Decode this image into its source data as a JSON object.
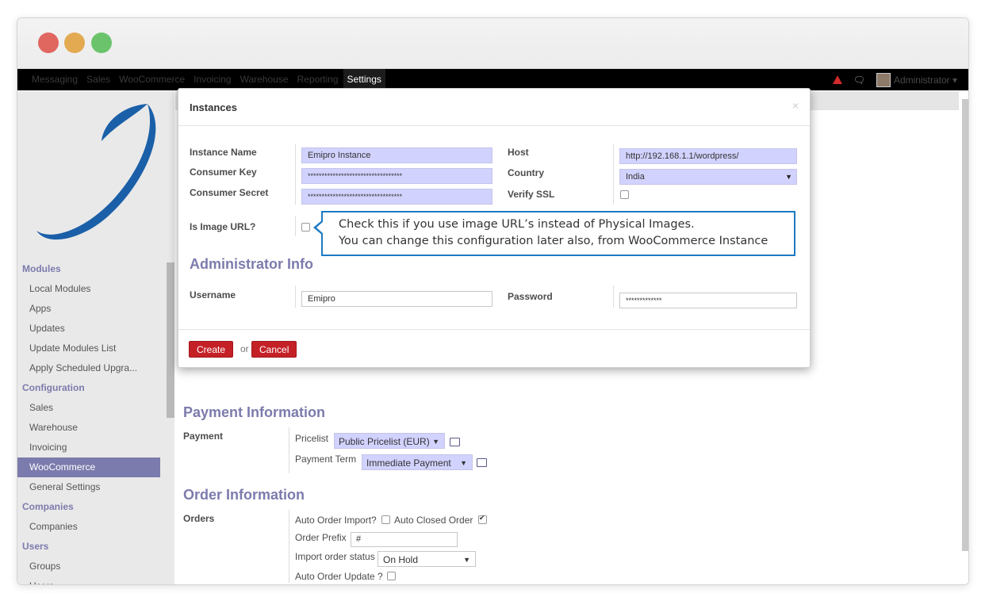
{
  "topnav": {
    "menu": [
      "Messaging",
      "Sales",
      "WooCommerce",
      "Invoicing",
      "Warehouse",
      "Reporting",
      "Settings"
    ],
    "active": "Settings",
    "user": "Administrator"
  },
  "sidebar": {
    "sections": [
      {
        "title": "Modules",
        "items": [
          "Local Modules",
          "Apps",
          "Updates",
          "Update Modules List",
          "Apply Scheduled Upgra..."
        ]
      },
      {
        "title": "Configuration",
        "items": [
          "Sales",
          "Warehouse",
          "Invoicing",
          "WooCommerce",
          "General Settings"
        ]
      },
      {
        "title": "Companies",
        "items": [
          "Companies"
        ]
      },
      {
        "title": "Users",
        "items": [
          "Groups",
          "Users"
        ]
      }
    ],
    "active_item": "WooCommerce"
  },
  "main": {
    "payment_title": "Payment Information",
    "payment_label": "Payment",
    "pricelist_label": "Pricelist",
    "pricelist_value": "Public Pricelist (EUR)",
    "payment_term_label": "Payment Term",
    "payment_term_value": "Immediate Payment",
    "order_title": "Order Information",
    "orders_label": "Orders",
    "auto_order_import_label": "Auto Order Import?",
    "auto_closed_order_label": "Auto Closed Order",
    "order_prefix_label": "Order Prefix",
    "order_prefix_value": "#",
    "import_status_label": "Import order status",
    "import_status_value": "On Hold",
    "auto_order_update_label": "Auto Order Update ?"
  },
  "modal": {
    "title": "Instances",
    "close": "×",
    "instance_name_label": "Instance Name",
    "instance_name_value": "Emipro Instance",
    "consumer_key_label": "Consumer Key",
    "consumer_key_value": "**********************************",
    "consumer_secret_label": "Consumer Secret",
    "consumer_secret_value": "**********************************",
    "host_label": "Host",
    "host_value": "http://192.168.1.1/wordpress/",
    "country_label": "Country",
    "country_value": "India",
    "verify_ssl_label": "Verify SSL",
    "image_url_label": "Is Image URL?",
    "admin_section": "Administrator Info",
    "username_label": "Username",
    "username_value": "Emipro",
    "password_label": "Password",
    "password_value": "*************",
    "create_label": "Create",
    "or_label": "or",
    "cancel_label": "Cancel"
  },
  "callout": {
    "line1": "Check this if you use image URL’s instead of Physical Images.",
    "line2": "You can change this configuration later also, from WooCommerce Instance"
  },
  "colors": {
    "accent": "#7c7bad",
    "field_bg": "#d2d2ff",
    "button_red": "#c42127",
    "callout_border": "#1d7ac1"
  }
}
